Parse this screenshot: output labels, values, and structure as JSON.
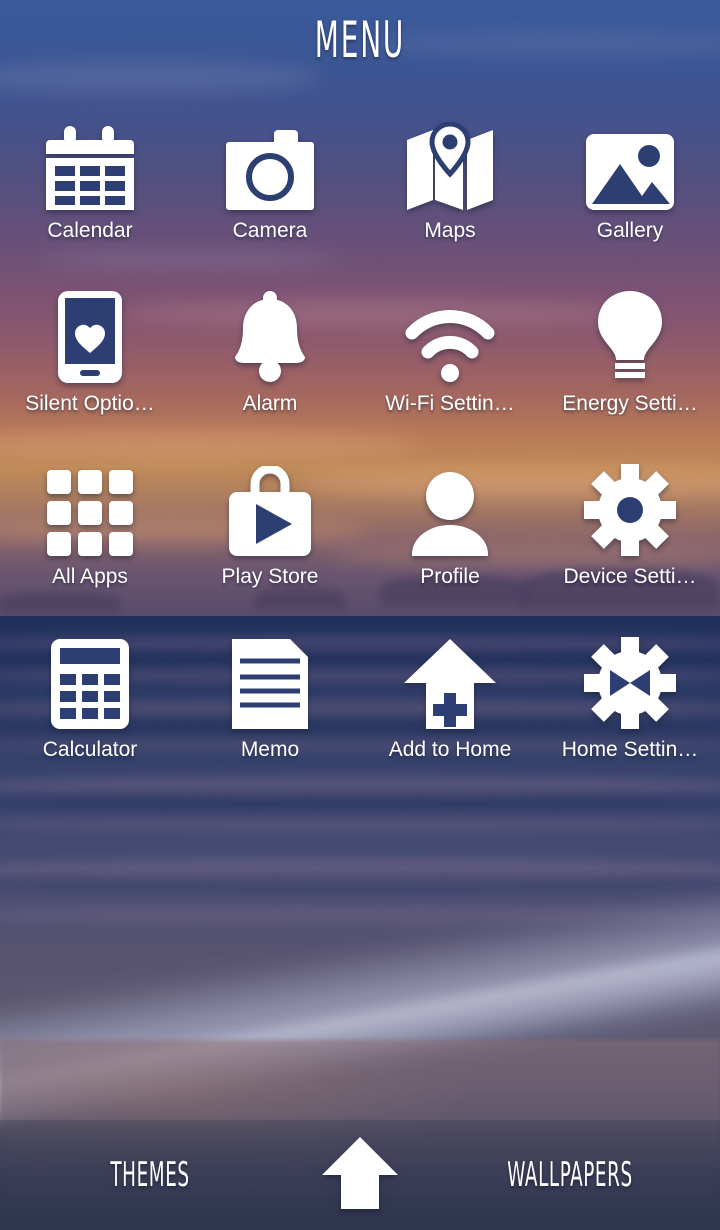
{
  "header": {
    "title": "MENU"
  },
  "theme": {
    "icon_color": "#ffffff",
    "label_color": "#ffffff",
    "sky_top": "#3a5a9b",
    "sky_horizon": "#c08a58",
    "sea": "#2b3a66",
    "dock_bg": "#2e3450"
  },
  "menu": {
    "rows": [
      [
        {
          "label": "Calendar",
          "icon": "calendar-icon"
        },
        {
          "label": "Camera",
          "icon": "camera-icon"
        },
        {
          "label": "Maps",
          "icon": "map-pin-icon"
        },
        {
          "label": "Gallery",
          "icon": "photo-icon"
        }
      ],
      [
        {
          "label": "Silent Optio…",
          "icon": "phone-heart-icon"
        },
        {
          "label": "Alarm",
          "icon": "bell-icon"
        },
        {
          "label": "Wi-Fi Settin…",
          "icon": "wifi-icon"
        },
        {
          "label": "Energy Setti…",
          "icon": "lightbulb-icon"
        }
      ],
      [
        {
          "label": "All Apps",
          "icon": "app-grid-icon"
        },
        {
          "label": "Play Store",
          "icon": "play-store-bag-icon"
        },
        {
          "label": "Profile",
          "icon": "person-icon"
        },
        {
          "label": "Device Setti…",
          "icon": "gear-icon"
        }
      ],
      [
        {
          "label": "Calculator",
          "icon": "calculator-icon"
        },
        {
          "label": "Memo",
          "icon": "note-lines-icon"
        },
        {
          "label": "Add to Home",
          "icon": "house-plus-icon"
        },
        {
          "label": "Home Settin…",
          "icon": "gear-bowtie-icon"
        }
      ]
    ]
  },
  "dock": {
    "themes_label": "THEMES",
    "wallpapers_label": "WALLPAPERS",
    "home_icon": "up-arrow-home-icon"
  }
}
